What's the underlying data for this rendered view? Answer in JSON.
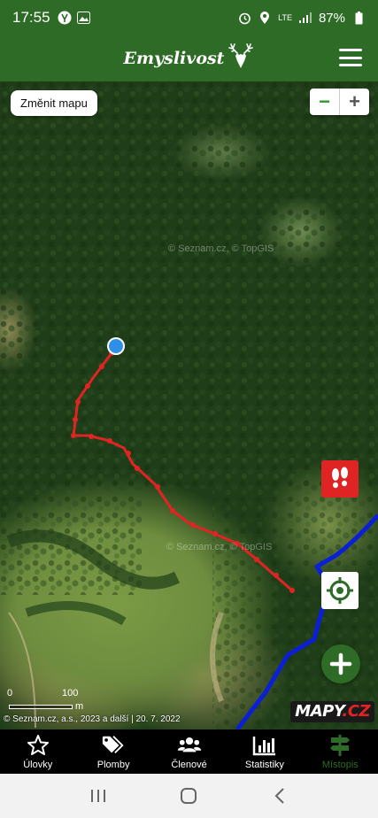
{
  "status_bar": {
    "time": "17:55",
    "network": "LTE",
    "battery": "87%"
  },
  "header": {
    "brand": "Emyslivost"
  },
  "map": {
    "change_map_label": "Změnit mapu",
    "watermark_1": "© Seznam.cz, © TopGIS",
    "watermark_2": "© Seznam.cz, © TopGIS",
    "scale_0": "0",
    "scale_100": "100",
    "scale_unit": "m",
    "copyright": "© Seznam.cz, a.s., 2023 a další | 20. 7. 2022",
    "logo_text": "MAPY",
    "logo_suffix": ".CZ"
  },
  "nav": {
    "items": [
      {
        "label": "Úlovky",
        "icon": "star-icon"
      },
      {
        "label": "Plomby",
        "icon": "tags-icon"
      },
      {
        "label": "Členové",
        "icon": "users-icon"
      },
      {
        "label": "Statistiky",
        "icon": "bar-chart-icon"
      },
      {
        "label": "Místopis",
        "icon": "signpost-icon"
      }
    ],
    "active_index": 4
  },
  "colors": {
    "brand_green": "#2e6b26",
    "track_red": "#e02424",
    "route_blue": "#0b1fd6",
    "location_blue": "#2f8fe8"
  }
}
